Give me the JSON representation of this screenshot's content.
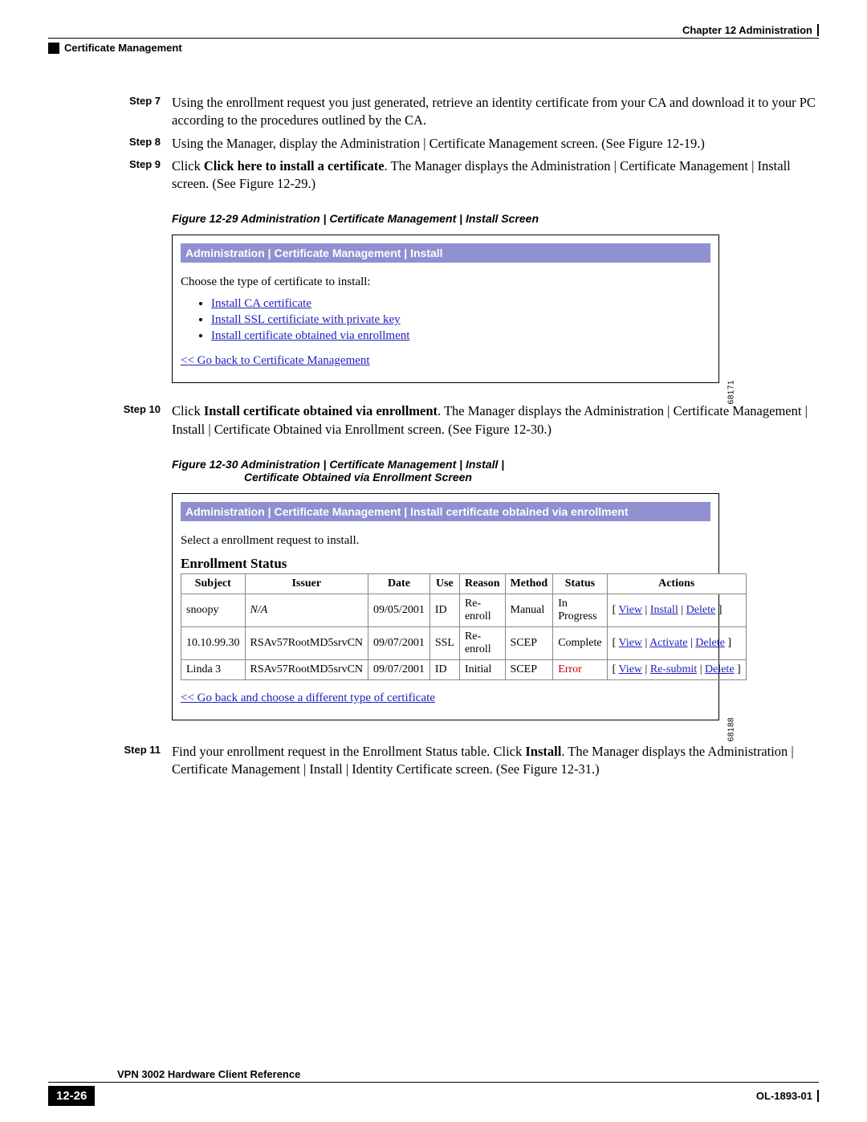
{
  "header": {
    "chapter": "Chapter 12    Administration",
    "section": "Certificate Management"
  },
  "steps": {
    "s7": {
      "label": "Step 7",
      "text_a": "Using the enrollment request you just generated, retrieve an identity certificate from your CA and download it to your PC according to the procedures outlined by the CA."
    },
    "s8": {
      "label": "Step 8",
      "text_a": "Using the Manager, display the Administration | Certificate Management screen. (See ",
      "figref": "Figure 12-19",
      "text_b": ".)"
    },
    "s9": {
      "label": "Step 9",
      "text_a": "Click ",
      "bold": "Click here to install a certificate",
      "text_b": ". The Manager displays the Administration | Certificate Management | Install screen. (See ",
      "figref": "Figure 12-29",
      "text_c": ".)"
    },
    "s10": {
      "label": "Step 10",
      "text_a": "Click ",
      "bold": "Install certificate obtained via enrollment",
      "text_b": ". The Manager displays the Administration | Certificate Management | Install | Certificate Obtained via Enrollment screen. (See ",
      "figref": "Figure 12-30",
      "text_c": ".)"
    },
    "s11": {
      "label": "Step 11",
      "text_a": "Find your enrollment request in the Enrollment Status table. Click ",
      "bold": "Install",
      "text_b": ". The Manager displays the Administration | Certificate Management | Install | Identity Certificate screen. (See ",
      "figref": "Figure 12-31",
      "text_c": ".)"
    }
  },
  "figureA": {
    "caption": "Figure 12-29 Administration | Certificate Management | Install Screen",
    "sideid": "68171",
    "title": "Administration | Certificate Management | Install",
    "prompt": "Choose the type of certificate to install:",
    "opt1": "Install CA certificate",
    "opt2": "Install SSL certificiate with private key",
    "opt3": "Install certificate obtained via enrollment",
    "back": "<< Go back to Certificate Management"
  },
  "figureB": {
    "caption_line1": "Figure 12-30 Administration | Certificate Management | Install |",
    "caption_line2": "Certificate Obtained via Enrollment Screen",
    "sideid": "68188",
    "title": "Administration | Certificate Management | Install certificate obtained via enrollment",
    "prompt": "Select a enrollment request to install.",
    "heading": "Enrollment Status",
    "cols": {
      "c0": "Subject",
      "c1": "Issuer",
      "c2": "Date",
      "c3": "Use",
      "c4": "Reason",
      "c5": "Method",
      "c6": "Status",
      "c7": "Actions"
    },
    "rows": [
      {
        "subject": "snoopy",
        "issuer": "N/A",
        "date": "09/05/2001",
        "use": "ID",
        "reason": "Re-enroll",
        "method": "Manual",
        "status": "In Progress",
        "a1": "View",
        "a2": "Install",
        "a3": "Delete",
        "err": false,
        "na": true
      },
      {
        "subject": "10.10.99.30",
        "issuer": "RSAv57RootMD5srvCN",
        "date": "09/07/2001",
        "use": "SSL",
        "reason": "Re-enroll",
        "method": "SCEP",
        "status": "Complete",
        "a1": "View",
        "a2": "Activate",
        "a3": "Delete",
        "err": false,
        "na": false
      },
      {
        "subject": "Linda 3",
        "issuer": "RSAv57RootMD5srvCN",
        "date": "09/07/2001",
        "use": "ID",
        "reason": "Initial",
        "method": "SCEP",
        "status": "Error",
        "a1": "View",
        "a2": "Re-submit",
        "a3": "Delete",
        "err": true,
        "na": false
      }
    ],
    "back": "<< Go back and choose a different type of certificate"
  },
  "footer": {
    "doc_title": "VPN 3002 Hardware Client Reference",
    "page": "12-26",
    "docid": "OL-1893-01"
  },
  "symbols": {
    "lbrack": "[ ",
    "rbrack": " ]",
    "sep": " | "
  }
}
